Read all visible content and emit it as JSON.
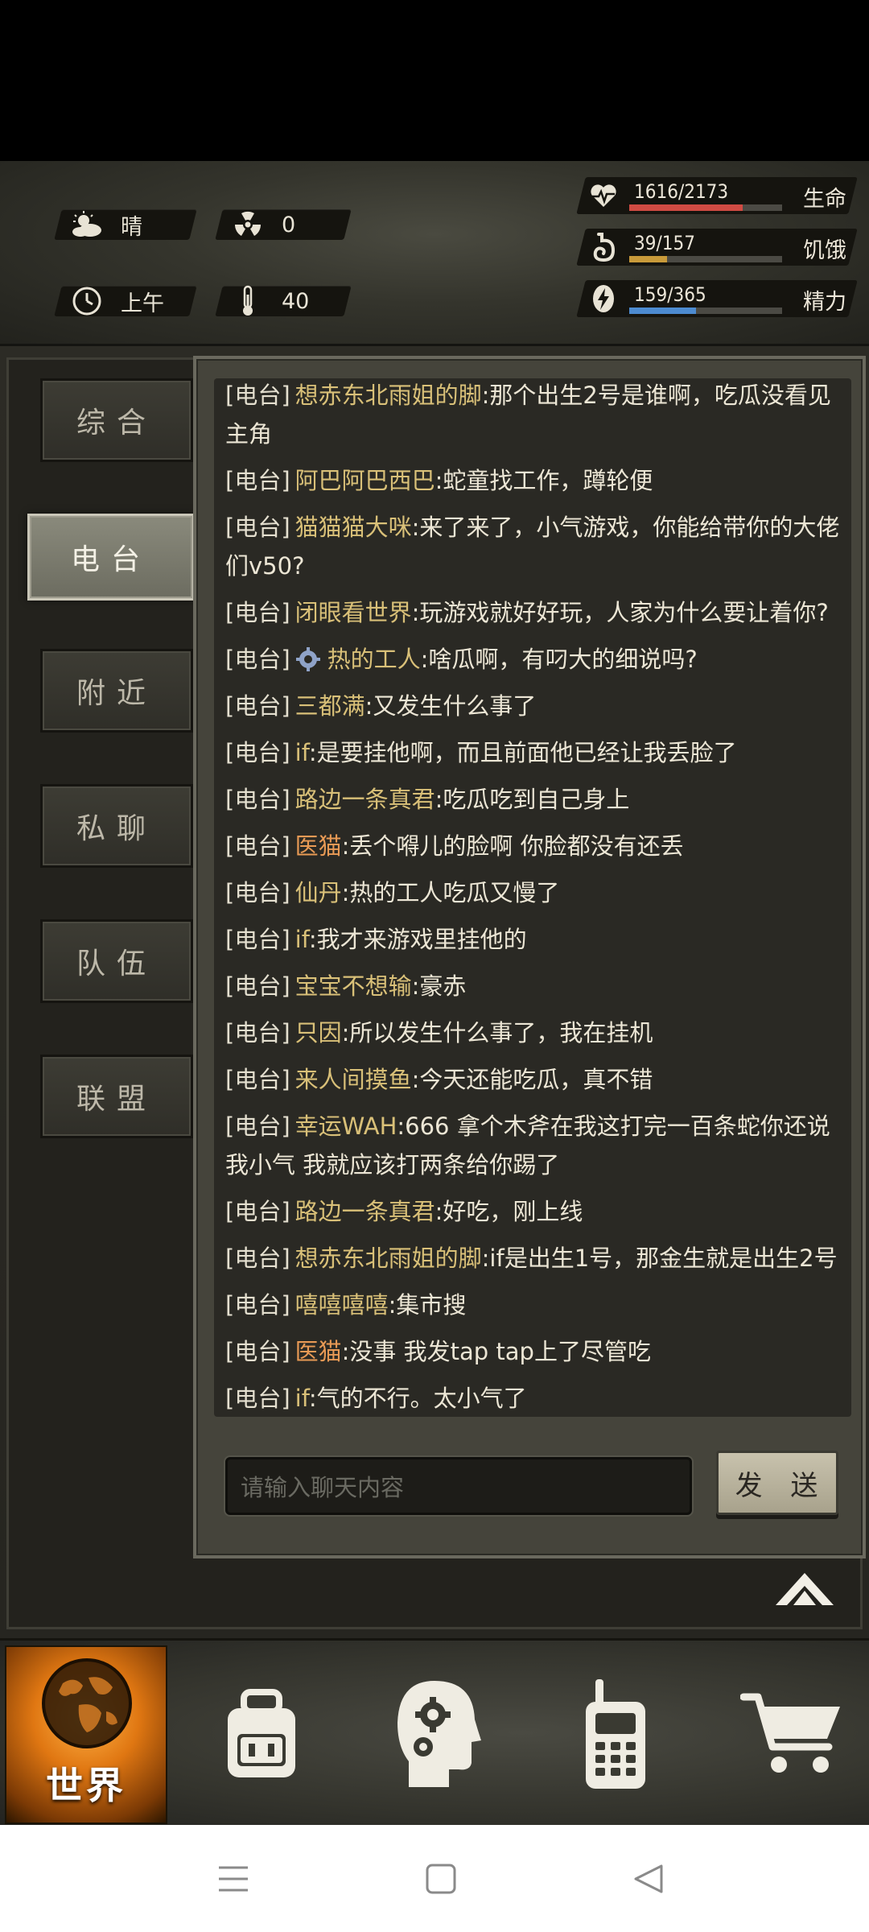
{
  "status": {
    "weather": "晴",
    "radiation": "0",
    "time_of_day": "上午",
    "temperature": "40"
  },
  "vitals": [
    {
      "name": "生命",
      "current": 1616,
      "max": 2173,
      "text": "1616/2173",
      "color": "#d04b43",
      "icon": "heart-pulse-icon"
    },
    {
      "name": "饥饿",
      "current": 39,
      "max": 157,
      "text": "39/157",
      "color": "#c89a3a",
      "icon": "stomach-icon"
    },
    {
      "name": "精力",
      "current": 159,
      "max": 365,
      "text": "159/365",
      "color": "#4d8bd0",
      "icon": "energy-icon"
    }
  ],
  "sidebar": {
    "tabs": [
      {
        "label": "综合",
        "active": false
      },
      {
        "label": "电台",
        "active": true
      },
      {
        "label": "附近",
        "active": false
      },
      {
        "label": "私聊",
        "active": false
      },
      {
        "label": "队伍",
        "active": false
      },
      {
        "label": "联盟",
        "active": false
      }
    ]
  },
  "chat": {
    "channel_tag": "[电台]",
    "messages": [
      {
        "tag": "[电台]",
        "nick": "想赤东北雨姐的脚",
        "text": ":那个出生2号是谁啊，吃瓜没看见主角",
        "nick_color": "gold"
      },
      {
        "tag": "[电台]",
        "nick": "阿巴阿巴西巴",
        "text": ":蛇童找工作，蹲轮便",
        "nick_color": "gold"
      },
      {
        "tag": "[电台]",
        "nick": "猫猫猫大咪",
        "text": ":来了来了，小气游戏，你能给带你的大佬们v50?",
        "nick_color": "gold"
      },
      {
        "tag": "[电台]",
        "nick": "闭眼看世界",
        "text": ":玩游戏就好好玩，人家为什么要让着你?",
        "nick_color": "gold"
      },
      {
        "tag": "[电台]",
        "nick": "热的工人",
        "text": ":啥瓜啊，有叼大的细说吗?",
        "nick_color": "gold",
        "badge": "gear-badge-icon"
      },
      {
        "tag": "[电台]",
        "nick": "三都满",
        "text": ":又发生什么事了",
        "nick_color": "gold"
      },
      {
        "tag": "[电台]",
        "nick": "if",
        "text": ":是要挂他啊，而且前面他已经让我丢脸了",
        "nick_color": "gold"
      },
      {
        "tag": "[电台]",
        "nick": "路边一条真君",
        "text": ":吃瓜吃到自己身上",
        "nick_color": "gold"
      },
      {
        "tag": "[电台]",
        "nick": "医猫",
        "text": ":丢个嘚儿的脸啊 你脸都没有还丢",
        "nick_color": "orange"
      },
      {
        "tag": "[电台]",
        "nick": "仙丹",
        "text": ":热的工人吃瓜又慢了",
        "nick_color": "gold"
      },
      {
        "tag": "[电台]",
        "nick": "if",
        "text": ":我才来游戏里挂他的",
        "nick_color": "gold"
      },
      {
        "tag": "[电台]",
        "nick": "宝宝不想输",
        "text": ":豪赤",
        "nick_color": "gold"
      },
      {
        "tag": "[电台]",
        "nick": "只因",
        "text": ":所以发生什么事了，我在挂机",
        "nick_color": "gold"
      },
      {
        "tag": "[电台]",
        "nick": "来人间摸鱼",
        "text": ":今天还能吃瓜，真不错",
        "nick_color": "gold"
      },
      {
        "tag": "[电台]",
        "nick": "幸运WAH",
        "text": ":666 拿个木斧在我这打完一百条蛇你还说我小气 我就应该打两条给你踢了",
        "nick_color": "gold"
      },
      {
        "tag": "[电台]",
        "nick": "路边一条真君",
        "text": ":好吃，刚上线",
        "nick_color": "gold"
      },
      {
        "tag": "[电台]",
        "nick": "想赤东北雨姐的脚",
        "text": ":if是出生1号，那金生就是出生2号",
        "nick_color": "gold"
      },
      {
        "tag": "[电台]",
        "nick": "嘻嘻嘻嘻",
        "text": ":集市搜",
        "nick_color": "gold"
      },
      {
        "tag": "[电台]",
        "nick": "医猫",
        "text": ":没事 我发tap tap上了尽管吃",
        "nick_color": "orange"
      },
      {
        "tag": "[电台]",
        "nick": "if",
        "text": ":气的不行。太小气了",
        "nick_color": "gold"
      }
    ],
    "input_placeholder": "请输入聊天内容",
    "send_label": "发 送"
  },
  "bottom_nav": [
    {
      "name": "world",
      "label": "世界",
      "icon": "globe-icon",
      "active": true
    },
    {
      "name": "backpack",
      "label": "",
      "icon": "backpack-icon"
    },
    {
      "name": "skills",
      "label": "",
      "icon": "head-gears-icon"
    },
    {
      "name": "radio",
      "label": "",
      "icon": "walkie-talkie-icon"
    },
    {
      "name": "shop",
      "label": "",
      "icon": "shopping-cart-icon"
    }
  ],
  "system_nav": [
    "menu-icon",
    "home-icon",
    "back-icon"
  ],
  "colors": {
    "accent_gold": "#d9c078",
    "accent_orange": "#e89a55",
    "world_orange": "#e07712"
  }
}
